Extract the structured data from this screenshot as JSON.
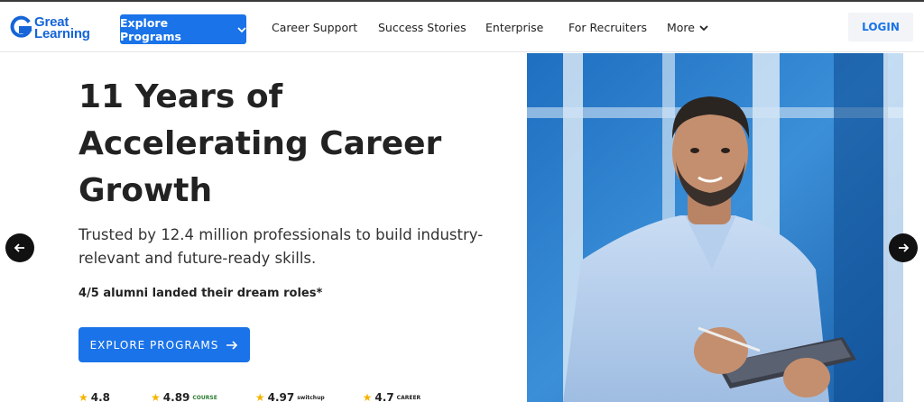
{
  "brand": {
    "line1": "Great",
    "line2": "Learning",
    "color": "#1565d8"
  },
  "nav": {
    "explore_label": "Explore Programs",
    "links": [
      "Career Support",
      "Success Stories",
      "Enterprise",
      "For Recruiters"
    ],
    "more_label": "More",
    "login_label": "LOGIN"
  },
  "hero": {
    "title_lines": [
      "11 Years of",
      "Accelerating Career",
      "Growth"
    ],
    "subtitle": "Trusted by 12.4 million professionals to build industry-relevant and future-ready skills.",
    "alumni": "4/5 alumni landed their dream roles*",
    "cta_label": "EXPLORE PROGRAMS"
  },
  "ratings": [
    {
      "value": "4.8",
      "source": ""
    },
    {
      "value": "4.89",
      "source": "COURSE"
    },
    {
      "value": "4.97",
      "source": "switchup"
    },
    {
      "value": "4.7",
      "source": "CAREER"
    }
  ],
  "colors": {
    "accent": "#1a73e8",
    "text": "#222222",
    "star": "#f6b400"
  },
  "icons": {
    "prev": "arrow-left-icon",
    "next": "arrow-right-icon",
    "chevron": "chevron-down-icon"
  }
}
